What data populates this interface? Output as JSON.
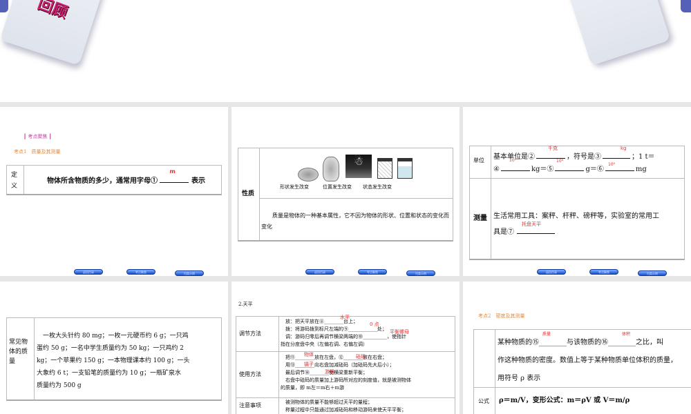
{
  "slides": [
    {
      "header_logo_text": "回顾"
    },
    {
      "section_tag": "┃ 考点聚焦 ┃",
      "topic": "考点1　质量及其测量",
      "row_label": "定义",
      "text_before": "物体所含物质的多少，通常用字母①",
      "answer": "m",
      "text_after": "表示"
    },
    {
      "row_label": "性质",
      "captions": [
        "形状发生改变",
        "位置发生改变",
        "状态发生改变"
      ],
      "text": "质量是物体的一种基本属性，它不因为物体的形状、位置和状态的变化而变化"
    },
    {
      "unit_label": "单位",
      "unit_line1": [
        "基本单位是②",
        "，符号是③",
        "；1 t＝"
      ],
      "unit_line2": [
        "④",
        "kg＝⑤",
        "g＝⑥",
        "mg"
      ],
      "answers": [
        "千克",
        "kg",
        "10³",
        "10⁶",
        "10⁹"
      ],
      "measure_label": "测量",
      "measure_text1": "生活常用工具：案秤、杆秤、磅秤等，实验室的常用工",
      "measure_text2": "具是⑦",
      "measure_answer": "托盘天平"
    },
    {
      "row_label": "常见物体的质量",
      "lines": [
        "　一枚大头针约 80 mg；一枚一元硬币约 6 g；一只鸡",
        "蛋约 50 g；一名中学生质量约为 50 kg；一只鸡约 2",
        "kg；一个苹果约 150 g；一本物理课本约 100 g；一头",
        "大象约 6 t；一支铅笔的质量约为 10 g；一瓶矿泉水",
        "质量约为 500 g"
      ]
    },
    {
      "title": "2.天平",
      "rows": [
        {
          "label": "调节方法",
          "lines": [
            "　放：把天平放在⑧________台上；",
            "　拨：将游码拨到标尺左端的⑨____________处；",
            "　调：游码归零后再调节横梁两端的⑩__________，使指针",
            "指在分度盘中央（左偏右调、右偏左调）"
          ],
          "answers": [
            "水平",
            "0 点",
            "平衡螺母"
          ]
        },
        {
          "label": "使用方法",
          "lines": [
            "　把⑪________放在左盘，⑫________放在右盘；",
            "　用⑬________向右盘加减砝码（加砝码先大后小）；",
            "　最后调节⑭________使横梁重新平衡；",
            "　右盘中砝码的质量加上游码所对应的刻度值，就是被测物体",
            "的质量，即 m左＝m右＋m游"
          ],
          "answers": [
            "物体",
            "砝码",
            "镊子",
            "游码"
          ]
        },
        {
          "label": "注意事项",
          "lines": [
            "　被测物体的质量不能够超过天平的量程；",
            "　称量过程中只能通过加减砝码和移动游码来使天平平衡；"
          ]
        }
      ]
    },
    {
      "topic": "考点2　密度及其测量",
      "def_lines": [
        "某种物质的⑮________与该物质的⑯________之比，叫",
        "作这种物质的密度。数值上等于某种物质单位体积的质量，",
        "用符号 ρ 表示"
      ],
      "answers": [
        "质量",
        "体积"
      ],
      "formula_label": "公式",
      "formula": "ρ＝m/V，变形公式：m＝ρV 或 V＝m/ρ"
    }
  ],
  "nav_buttons": [
    "返回目录",
    "考点聚焦",
    "归类示例"
  ],
  "colors": {
    "pink": "#c040a0",
    "orange": "#e08a40",
    "red": "#e03030",
    "gap": "#e6e6e6"
  }
}
